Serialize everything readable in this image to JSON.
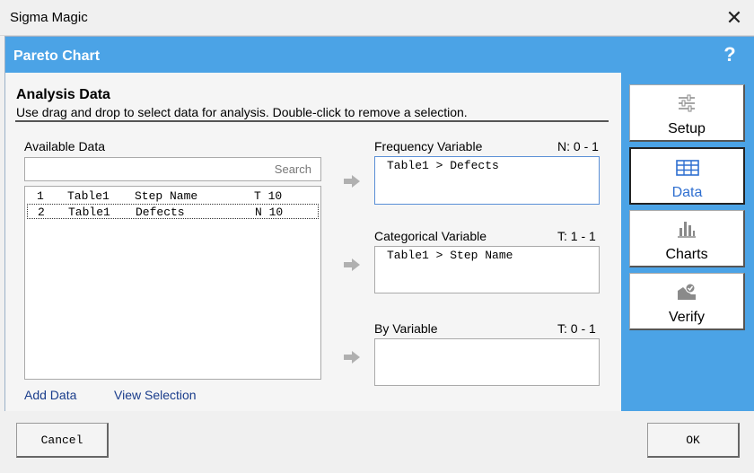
{
  "window": {
    "title": "Sigma Magic",
    "close_glyph": "✕"
  },
  "header": {
    "title": "Pareto Chart",
    "help_glyph": "?"
  },
  "section": {
    "title": "Analysis Data",
    "subtitle": "Use drag and drop to select data for analysis. Double-click to remove a selection."
  },
  "available": {
    "label": "Available Data",
    "search_placeholder": "Search",
    "rows": [
      {
        "num": "1",
        "table": "Table1",
        "name": "Step Name",
        "type": "T 10",
        "selected": false
      },
      {
        "num": "2",
        "table": "Table1",
        "name": "Defects",
        "type": "N 10",
        "selected": true
      }
    ],
    "add_data": "Add Data",
    "view_selection": "View Selection"
  },
  "frequency": {
    "label": "Frequency Variable",
    "constraint": "N: 0 - 1",
    "value": "Table1 > Defects"
  },
  "categorical": {
    "label": "Categorical Variable",
    "constraint": "T: 1 - 1",
    "value": "Table1 > Step Name"
  },
  "by": {
    "label": "By Variable",
    "constraint": "T: 0 - 1",
    "value": ""
  },
  "nav": [
    {
      "label": "Setup",
      "icon": "sliders-icon",
      "active": false
    },
    {
      "label": "Data",
      "icon": "table-icon",
      "active": true
    },
    {
      "label": "Charts",
      "icon": "bar-chart-icon",
      "active": false
    },
    {
      "label": "Verify",
      "icon": "verify-icon",
      "active": false
    }
  ],
  "buttons": {
    "cancel": "Cancel",
    "ok": "OK"
  },
  "colors": {
    "accent": "#4ba3e6",
    "active_nav": "#2f6fd0",
    "link": "#1a3d8c"
  }
}
